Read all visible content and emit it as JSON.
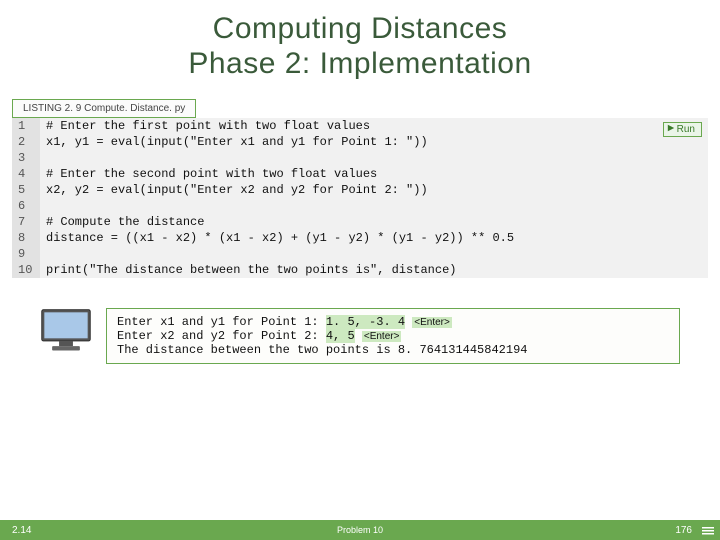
{
  "title": {
    "line1": "Computing Distances",
    "line2": "Phase 2: Implementation"
  },
  "listing_label": "LISTING 2. 9 Compute. Distance. py",
  "run_label": "Run",
  "code_lines": [
    "# Enter the first point with two float values",
    "x1, y1 = eval(input(\"Enter x1 and y1 for Point 1: \"))",
    "",
    "# Enter the second point with two float values",
    "x2, y2 = eval(input(\"Enter x2 and y2 for Point 2: \"))",
    "",
    "# Compute the distance",
    "distance = ((x1 - x2) * (x1 - x2) + (y1 - y2) * (y1 - y2)) ** 0.5",
    "",
    "print(\"The distance between the two points is\", distance)"
  ],
  "line_numbers": [
    "1",
    "2",
    "3",
    "4",
    "5",
    "6",
    "7",
    "8",
    "9",
    "10"
  ],
  "output": {
    "line1_prefix": "Enter x1 and y1 for Point 1: ",
    "line1_value": "1. 5, -3. 4",
    "line2_prefix": "Enter x2 and y2 for Point 2: ",
    "line2_value": "4, 5",
    "enter_label": "<Enter>",
    "line3": "The distance between the two points is 8. 764131445842194"
  },
  "footer": {
    "left": "2.14",
    "center": "Problem 10",
    "right": "176"
  }
}
